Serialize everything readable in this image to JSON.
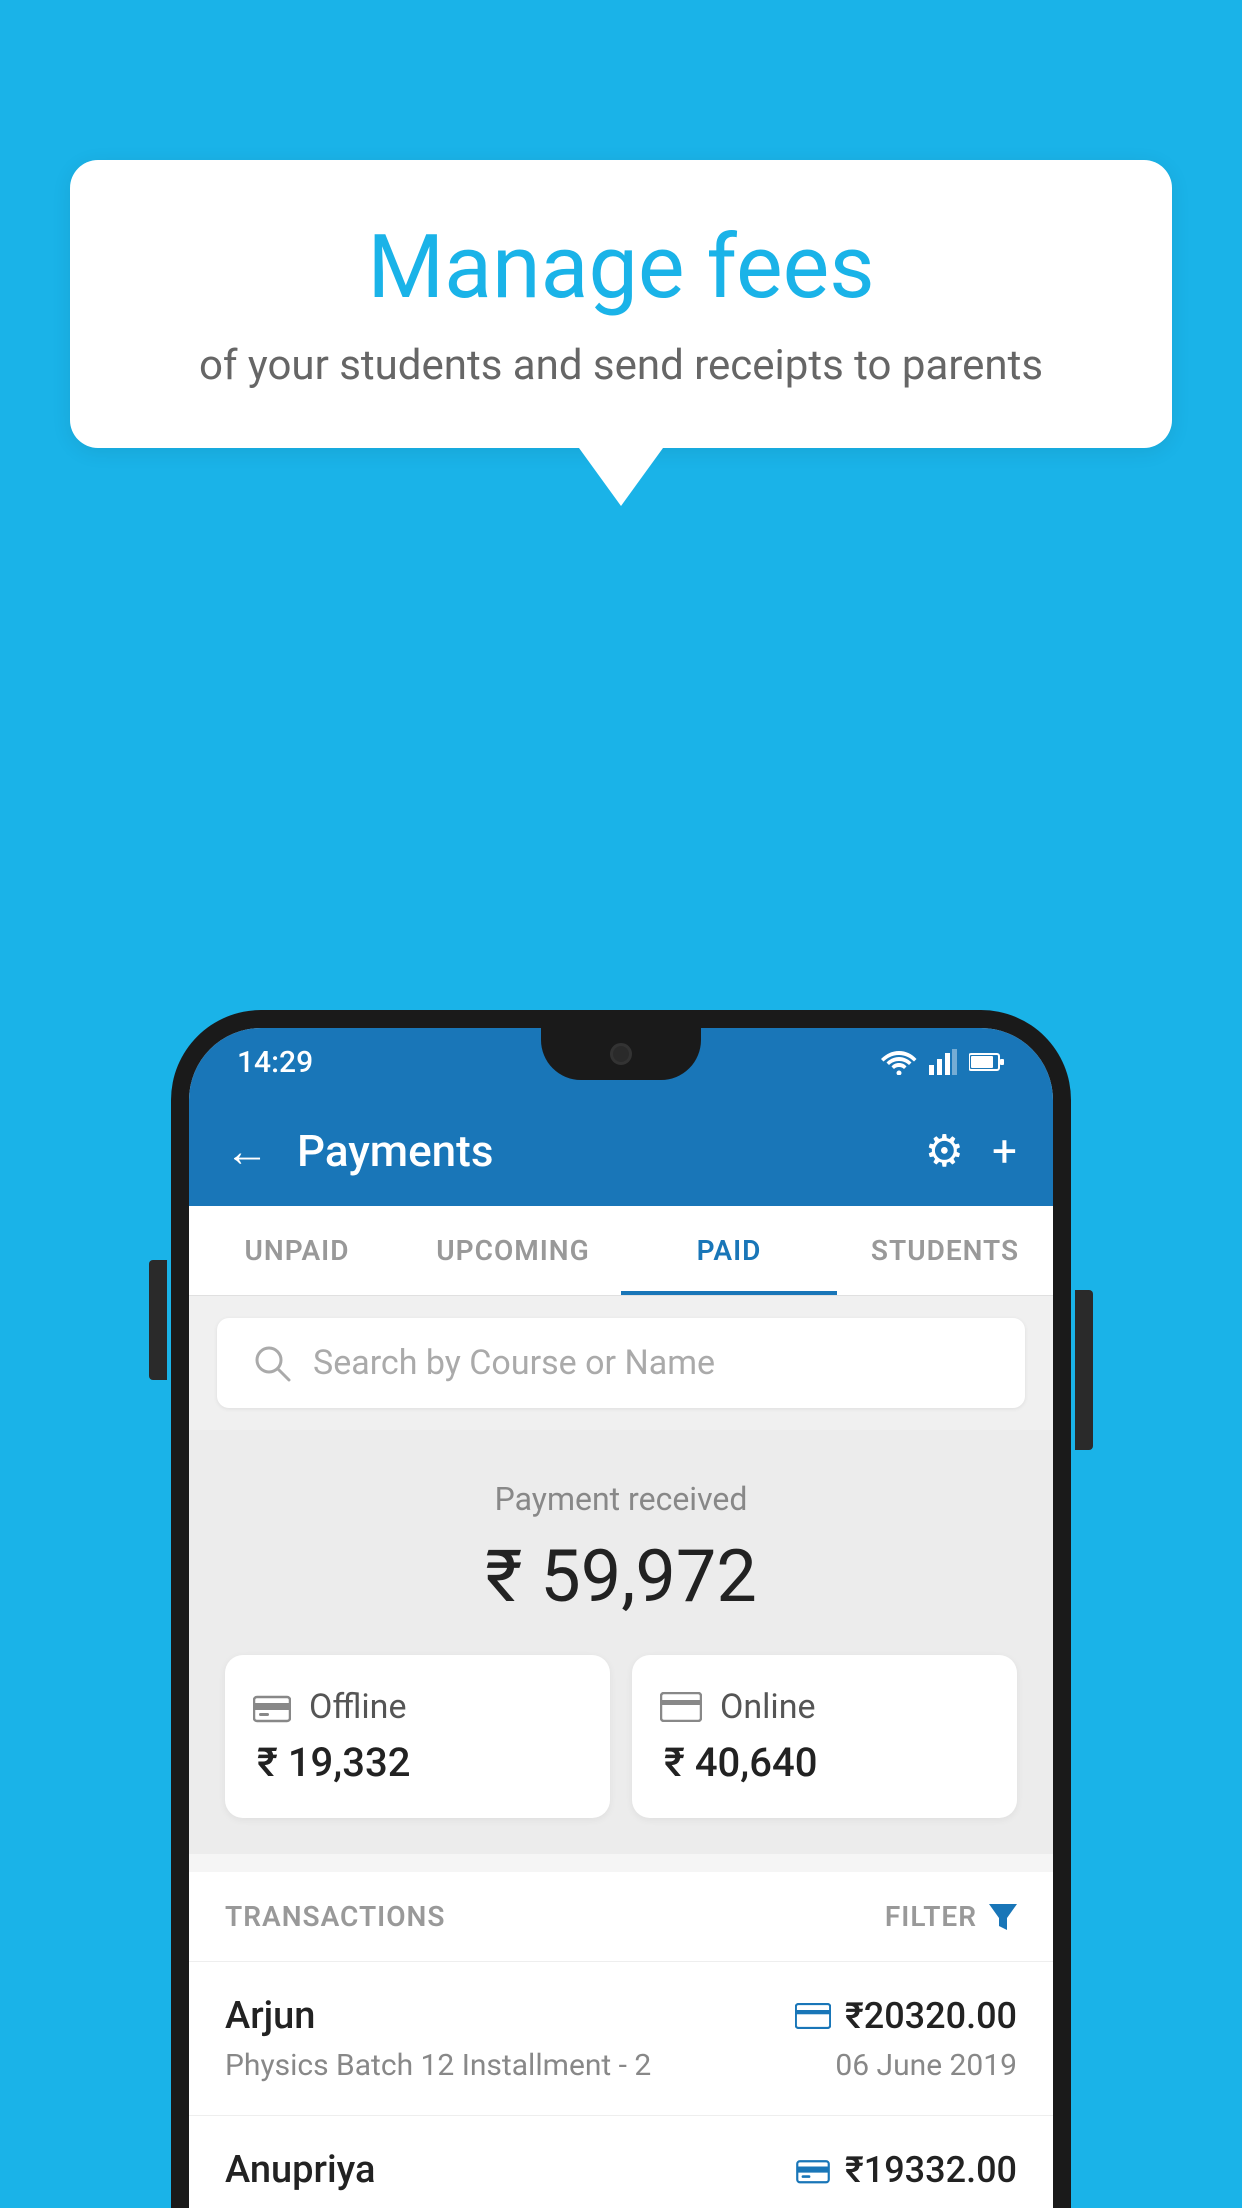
{
  "page": {
    "background_color": "#1ab3e8"
  },
  "speech_bubble": {
    "title": "Manage fees",
    "subtitle": "of your students and send receipts to parents"
  },
  "status_bar": {
    "time": "14:29",
    "wifi_icon": "wifi",
    "signal_icon": "signal",
    "battery_icon": "battery"
  },
  "app_bar": {
    "title": "Payments",
    "back_label": "←",
    "settings_label": "⚙",
    "add_label": "+"
  },
  "tabs": [
    {
      "label": "UNPAID",
      "active": false
    },
    {
      "label": "UPCOMING",
      "active": false
    },
    {
      "label": "PAID",
      "active": true
    },
    {
      "label": "STUDENTS",
      "active": false
    }
  ],
  "search": {
    "placeholder": "Search by Course or Name"
  },
  "payment_summary": {
    "received_label": "Payment received",
    "total_amount": "₹ 59,972",
    "offline_label": "Offline",
    "offline_amount": "₹ 19,332",
    "online_label": "Online",
    "online_amount": "₹ 40,640"
  },
  "transactions": {
    "header_label": "TRANSACTIONS",
    "filter_label": "FILTER",
    "rows": [
      {
        "name": "Arjun",
        "course": "Physics Batch 12 Installment - 2",
        "amount": "₹20320.00",
        "date": "06 June 2019",
        "payment_type": "online"
      },
      {
        "name": "Anupriya",
        "course": "",
        "amount": "₹19332.00",
        "date": "",
        "payment_type": "offline"
      }
    ]
  }
}
